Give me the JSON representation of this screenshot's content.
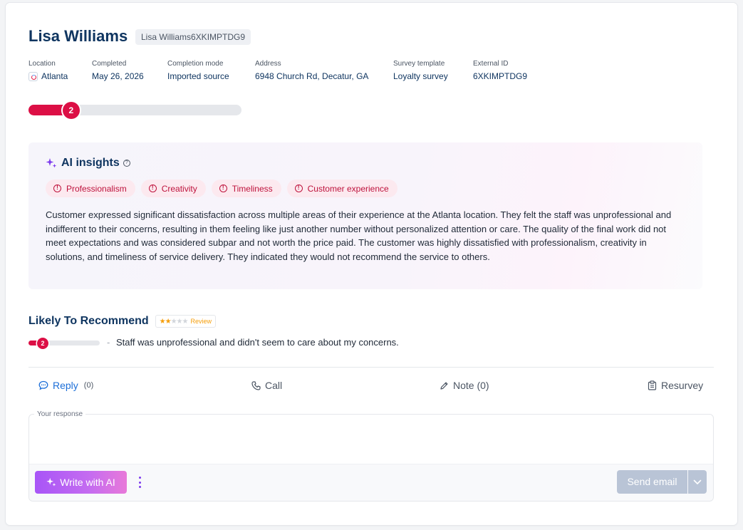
{
  "customer": {
    "name": "Lisa Williams",
    "id_chip": "Lisa Williams6XKIMPTDG9"
  },
  "meta": [
    {
      "label": "Location",
      "value": "Atlanta"
    },
    {
      "label": "Completed",
      "value": "May 26, 2026"
    },
    {
      "label": "Completion mode",
      "value": "Imported source"
    },
    {
      "label": "Address",
      "value": "6948 Church Rd, Decatur, GA"
    },
    {
      "label": "Survey template",
      "value": "Loyalty survey"
    },
    {
      "label": "External ID",
      "value": "6XKIMPTDG9"
    }
  ],
  "overall_score": {
    "value": "2",
    "fraction": 0.2
  },
  "insights": {
    "title": "AI insights",
    "help": "?",
    "tags": [
      "Professionalism",
      "Creativity",
      "Timeliness",
      "Customer experience"
    ],
    "warn_glyph": "!",
    "summary": "Customer expressed significant dissatisfaction across multiple areas of their experience at the Atlanta location. They felt the staff was unprofessional and indifferent to their concerns, resulting in them feeling like just another number without personalized attention or care. The quality of the final work did not meet expectations and was considered subpar and not worth the price paid. The customer was highly dissatisfied with professionalism, creativity in solutions, and timeliness of service delivery. They indicated they would not recommend the service to others."
  },
  "likely_to_recommend": {
    "title": "Likely To Recommend",
    "stars_filled": 2,
    "stars_total": 5,
    "review_label": "Review",
    "score": "2",
    "fraction": 0.2,
    "separator": "-",
    "comment": "Staff was unprofessional and didn't seem to care about my concerns."
  },
  "actions": {
    "reply": {
      "label": "Reply",
      "count": "(0)"
    },
    "call": {
      "label": "Call"
    },
    "note": {
      "label": "Note (0)"
    },
    "resurvey": {
      "label": "Resurvey"
    }
  },
  "response": {
    "legend": "Your response",
    "write_ai": "Write with AI",
    "send": "Send email"
  },
  "colors": {
    "brand": "#0f3560",
    "score_red": "#dc0f45",
    "reply_blue": "#1d6fd8",
    "ai_purple": "#a855f7"
  },
  "icons": [
    "location-icon",
    "sparkle-icon",
    "help-icon",
    "warning-icon",
    "star-icon",
    "chat-icon",
    "phone-icon",
    "pencil-icon",
    "clipboard-icon",
    "kebab-icon",
    "chevron-down-icon"
  ]
}
